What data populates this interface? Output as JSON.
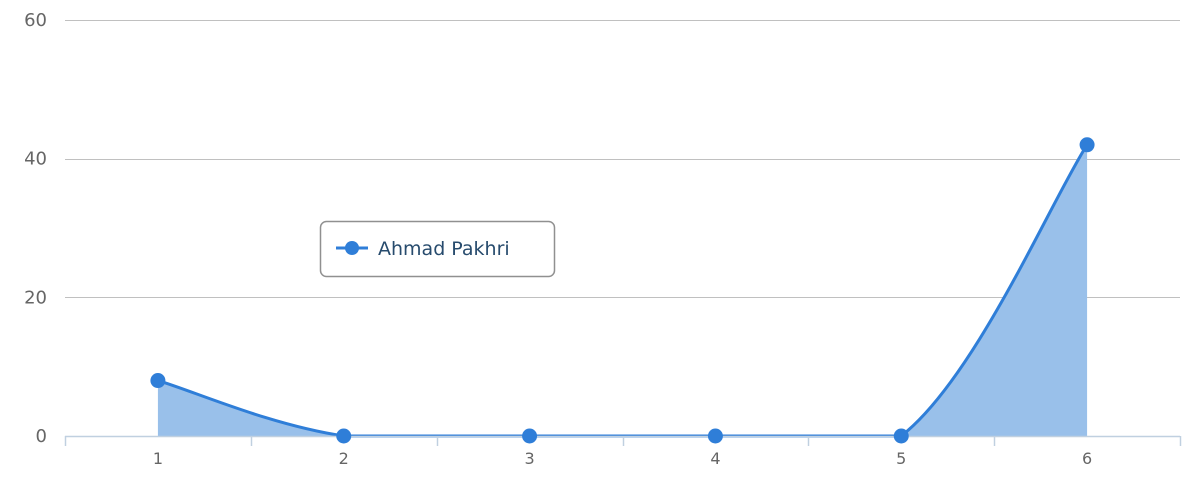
{
  "chart_data": {
    "type": "area",
    "x": [
      1,
      2,
      3,
      4,
      5,
      6
    ],
    "series": [
      {
        "name": "Ahmad Pakhri",
        "values": [
          8,
          0,
          0,
          0,
          0,
          42
        ],
        "color": "#2f7ed8",
        "fill_color": "#99c0ea"
      }
    ],
    "x_tick_labels": [
      "1",
      "2",
      "3",
      "4",
      "5",
      "6"
    ],
    "y_tick_labels": [
      "0",
      "20",
      "40",
      "60"
    ],
    "y_ticks": [
      0,
      20,
      40,
      60
    ],
    "ylim": [
      0,
      60
    ],
    "xlim": [
      0.5,
      6.5
    ],
    "title": "",
    "xlabel": "",
    "ylabel": "",
    "grid": true,
    "legend_position": "left-middle",
    "colors": {
      "gridline": "#c0c0c0",
      "axis": "#c0d0e0",
      "tick_text": "#666666",
      "legend_border": "#909090",
      "legend_text": "#274b6d"
    }
  }
}
